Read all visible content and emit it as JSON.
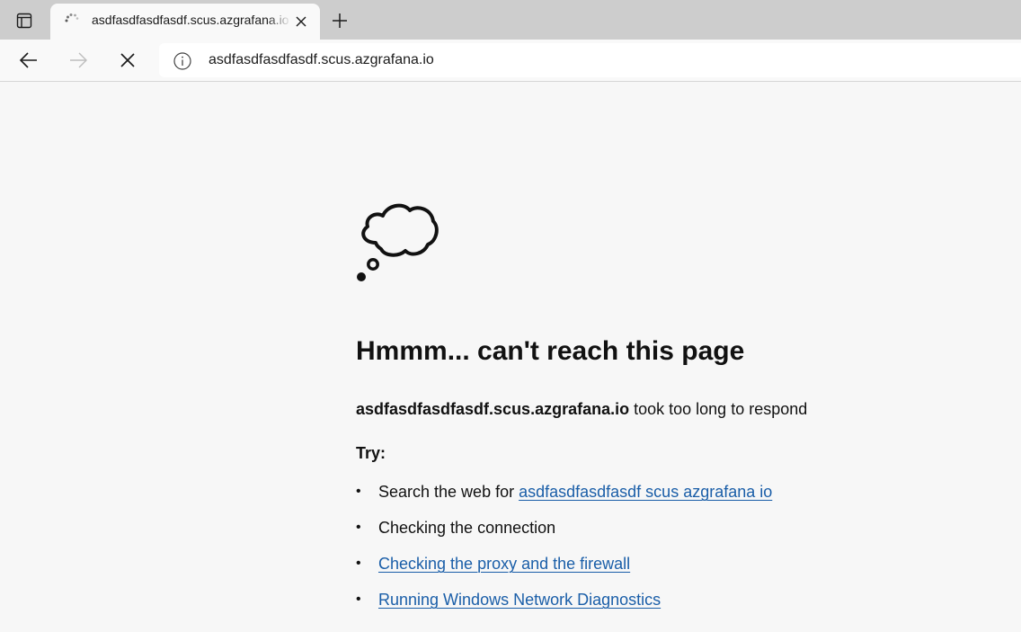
{
  "browser": {
    "tab": {
      "title": "asdfasdfasdfasdf.scus.azgrafana.io",
      "icon": "loading-spinner-icon"
    },
    "new_tab_icon": "plus-icon",
    "tab_actions_icon": "tab-actions-icon",
    "toolbar": {
      "back_icon": "arrow-left-icon",
      "forward_icon": "arrow-right-icon",
      "stop_icon": "close-icon",
      "site_info_icon": "info-icon",
      "url": "asdfasdfasdfasdf.scus.azgrafana.io"
    }
  },
  "error_page": {
    "icon": "thought-bubble-icon",
    "heading": "Hmmm... can't reach this page",
    "host": "asdfasdfasdfasdf.scus.azgrafana.io",
    "message": " took too long to respond",
    "try_label": "Try:",
    "suggestions": {
      "search_prefix": "Search the web for ",
      "search_link": "asdfasdfasdfasdf scus azgrafana io",
      "connection": "Checking the connection",
      "proxy_link": "Checking the proxy and the firewall",
      "diagnostics_link": "Running Windows Network Diagnostics"
    },
    "bullet": "•"
  },
  "colors": {
    "tabstrip_bg": "#cdcdcd",
    "page_bg": "#f7f7f7",
    "link": "#1a5ea8"
  }
}
